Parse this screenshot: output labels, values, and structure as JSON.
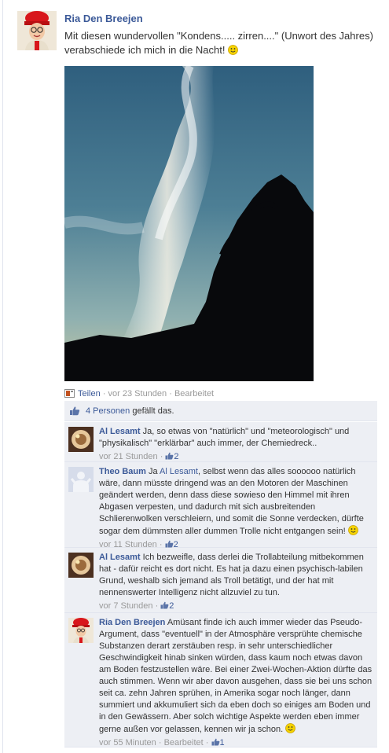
{
  "post": {
    "author": "Ria Den Breejen",
    "text": "Mit diesen wundervollen \"Kondens..... zirren....\" (Unwort des Jahres) verabschiede ich mich in die Nacht!",
    "share_label": "Teilen",
    "time": "vor 23 Stunden",
    "edited": "Bearbeitet",
    "sep": "·"
  },
  "likes": {
    "count_label": "4 Personen",
    "suffix": "gefällt das."
  },
  "comments": [
    {
      "author": "Al Lesamt",
      "text": "Ja, so etwas von \"natürlich\" und \"meteorologisch\" und \"physikalisch\" \"erklärbar\" auch immer, der Chemiedreck..",
      "time": "vor 21 Stunden",
      "likes": "2"
    },
    {
      "author": "Theo Baum",
      "pre": "Ja",
      "mention": "Al Lesamt",
      "text": ", selbst wenn das alles soooooo natürlich wäre, dann müsste dringend was an den Motoren der Maschinen geändert werden, denn dass diese sowieso den Himmel mit ihren Abgasen verpesten, und dadurch mit sich ausbreitenden Schlierenwolken verschleiern, und somit die Sonne verdecken, dürfte sogar dem dümmsten aller dummen Trolle nicht entgangen sein!",
      "time": "vor 11 Stunden",
      "likes": "2"
    },
    {
      "author": "Al Lesamt",
      "text": "Ich bezweifle, dass derlei die Trollabteilung mitbekommen hat - dafür reicht es dort nicht. Es hat ja dazu einen psychisch-labilen Grund, weshalb sich jemand als Troll betätigt, und der hat mit nennenswerter Intelligenz nicht allzuviel zu tun.",
      "time": "vor 7 Stunden",
      "likes": "2"
    },
    {
      "author": "Ria Den Breejen",
      "text": "Amüsant finde ich auch immer wieder das Pseudo-Argument, dass \"eventuell\" in der Atmosphäre versprühte chemische Substanzen derart zerstäuben resp. in sehr unterschiedlicher Geschwindigkeit hinab sinken würden, dass kaum noch etwas davon am Boden festzustellen wäre. Bei einer Zwei-Wochen-Aktion dürfte das auch stimmen. Wenn wir aber davon ausgehen, dass sie bei uns schon seit ca. zehn Jahren sprühen, in Amerika sogar noch länger, dann summiert und akkumuliert sich da eben doch so einiges am Boden und in den Gewässern. Aber solch wichtige Aspekte werden eben immer gerne außen vor gelassen, kennen wir ja schon.",
      "time": "vor 55 Minuten",
      "edited": "Bearbeitet",
      "likes": "1"
    }
  ],
  "colors": {
    "link": "#3b5998",
    "comment_bg": "#edeff4",
    "meta": "#999999"
  },
  "icons": [
    "share-icon",
    "like-thumb-icon",
    "smiley-icon",
    "avatar-ria",
    "avatar-al",
    "avatar-theo"
  ]
}
